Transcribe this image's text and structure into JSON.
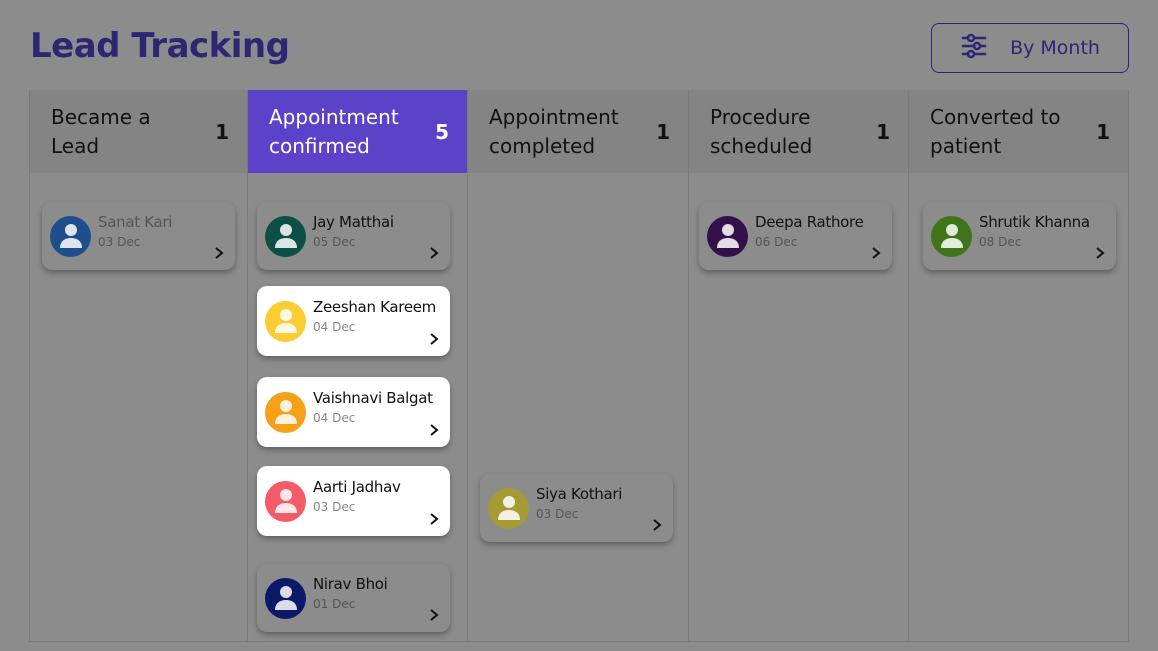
{
  "header": {
    "title": "Lead Tracking",
    "filter_label": "By Month",
    "filter_icon": "sliders-icon"
  },
  "colors": {
    "title": "#2e2573",
    "active_header": "#5b42c8",
    "overlay_background": "#8c8c8c"
  },
  "columns": [
    {
      "title": "Became a Lead",
      "count": "1",
      "active": false,
      "cards": [
        {
          "name": "Sanat Kari",
          "date": "03 Dec",
          "avatar_color": "#1f4e8c",
          "highlighted": false
        }
      ]
    },
    {
      "title": "Appointment confirmed",
      "count": "5",
      "active": true,
      "cards": [
        {
          "name": "Jay Matthai",
          "date": "05 Dec",
          "avatar_color": "#0d4f47",
          "highlighted": false
        },
        {
          "name": "Zeeshan Kareem",
          "date": "04 Dec",
          "avatar_color": "#fbcd32",
          "highlighted": true
        },
        {
          "name": "Vaishnavi Balgat",
          "date": "04 Dec",
          "avatar_color": "#f6a01a",
          "highlighted": true
        },
        {
          "name": "Aarti Jadhav",
          "date": "03 Dec",
          "avatar_color": "#f45b68",
          "highlighted": true
        },
        {
          "name": "Nirav Bhoi",
          "date": "01 Dec",
          "avatar_color": "#0a1a66",
          "highlighted": false
        }
      ]
    },
    {
      "title": "Appointment completed",
      "count": "1",
      "active": false,
      "cards": [
        {
          "name": "Siya Kothari",
          "date": "03 Dec",
          "avatar_color": "#a59a34",
          "highlighted": false
        }
      ]
    },
    {
      "title": "Procedure scheduled",
      "count": "1",
      "active": false,
      "cards": [
        {
          "name": "Deepa Rathore",
          "date": "06 Dec",
          "avatar_color": "#34104a",
          "highlighted": false
        }
      ]
    },
    {
      "title": "Converted to patient",
      "count": "1",
      "active": false,
      "cards": [
        {
          "name": "Shrutik Khanna",
          "date": "08 Dec",
          "avatar_color": "#3f7419",
          "highlighted": false
        }
      ]
    }
  ]
}
